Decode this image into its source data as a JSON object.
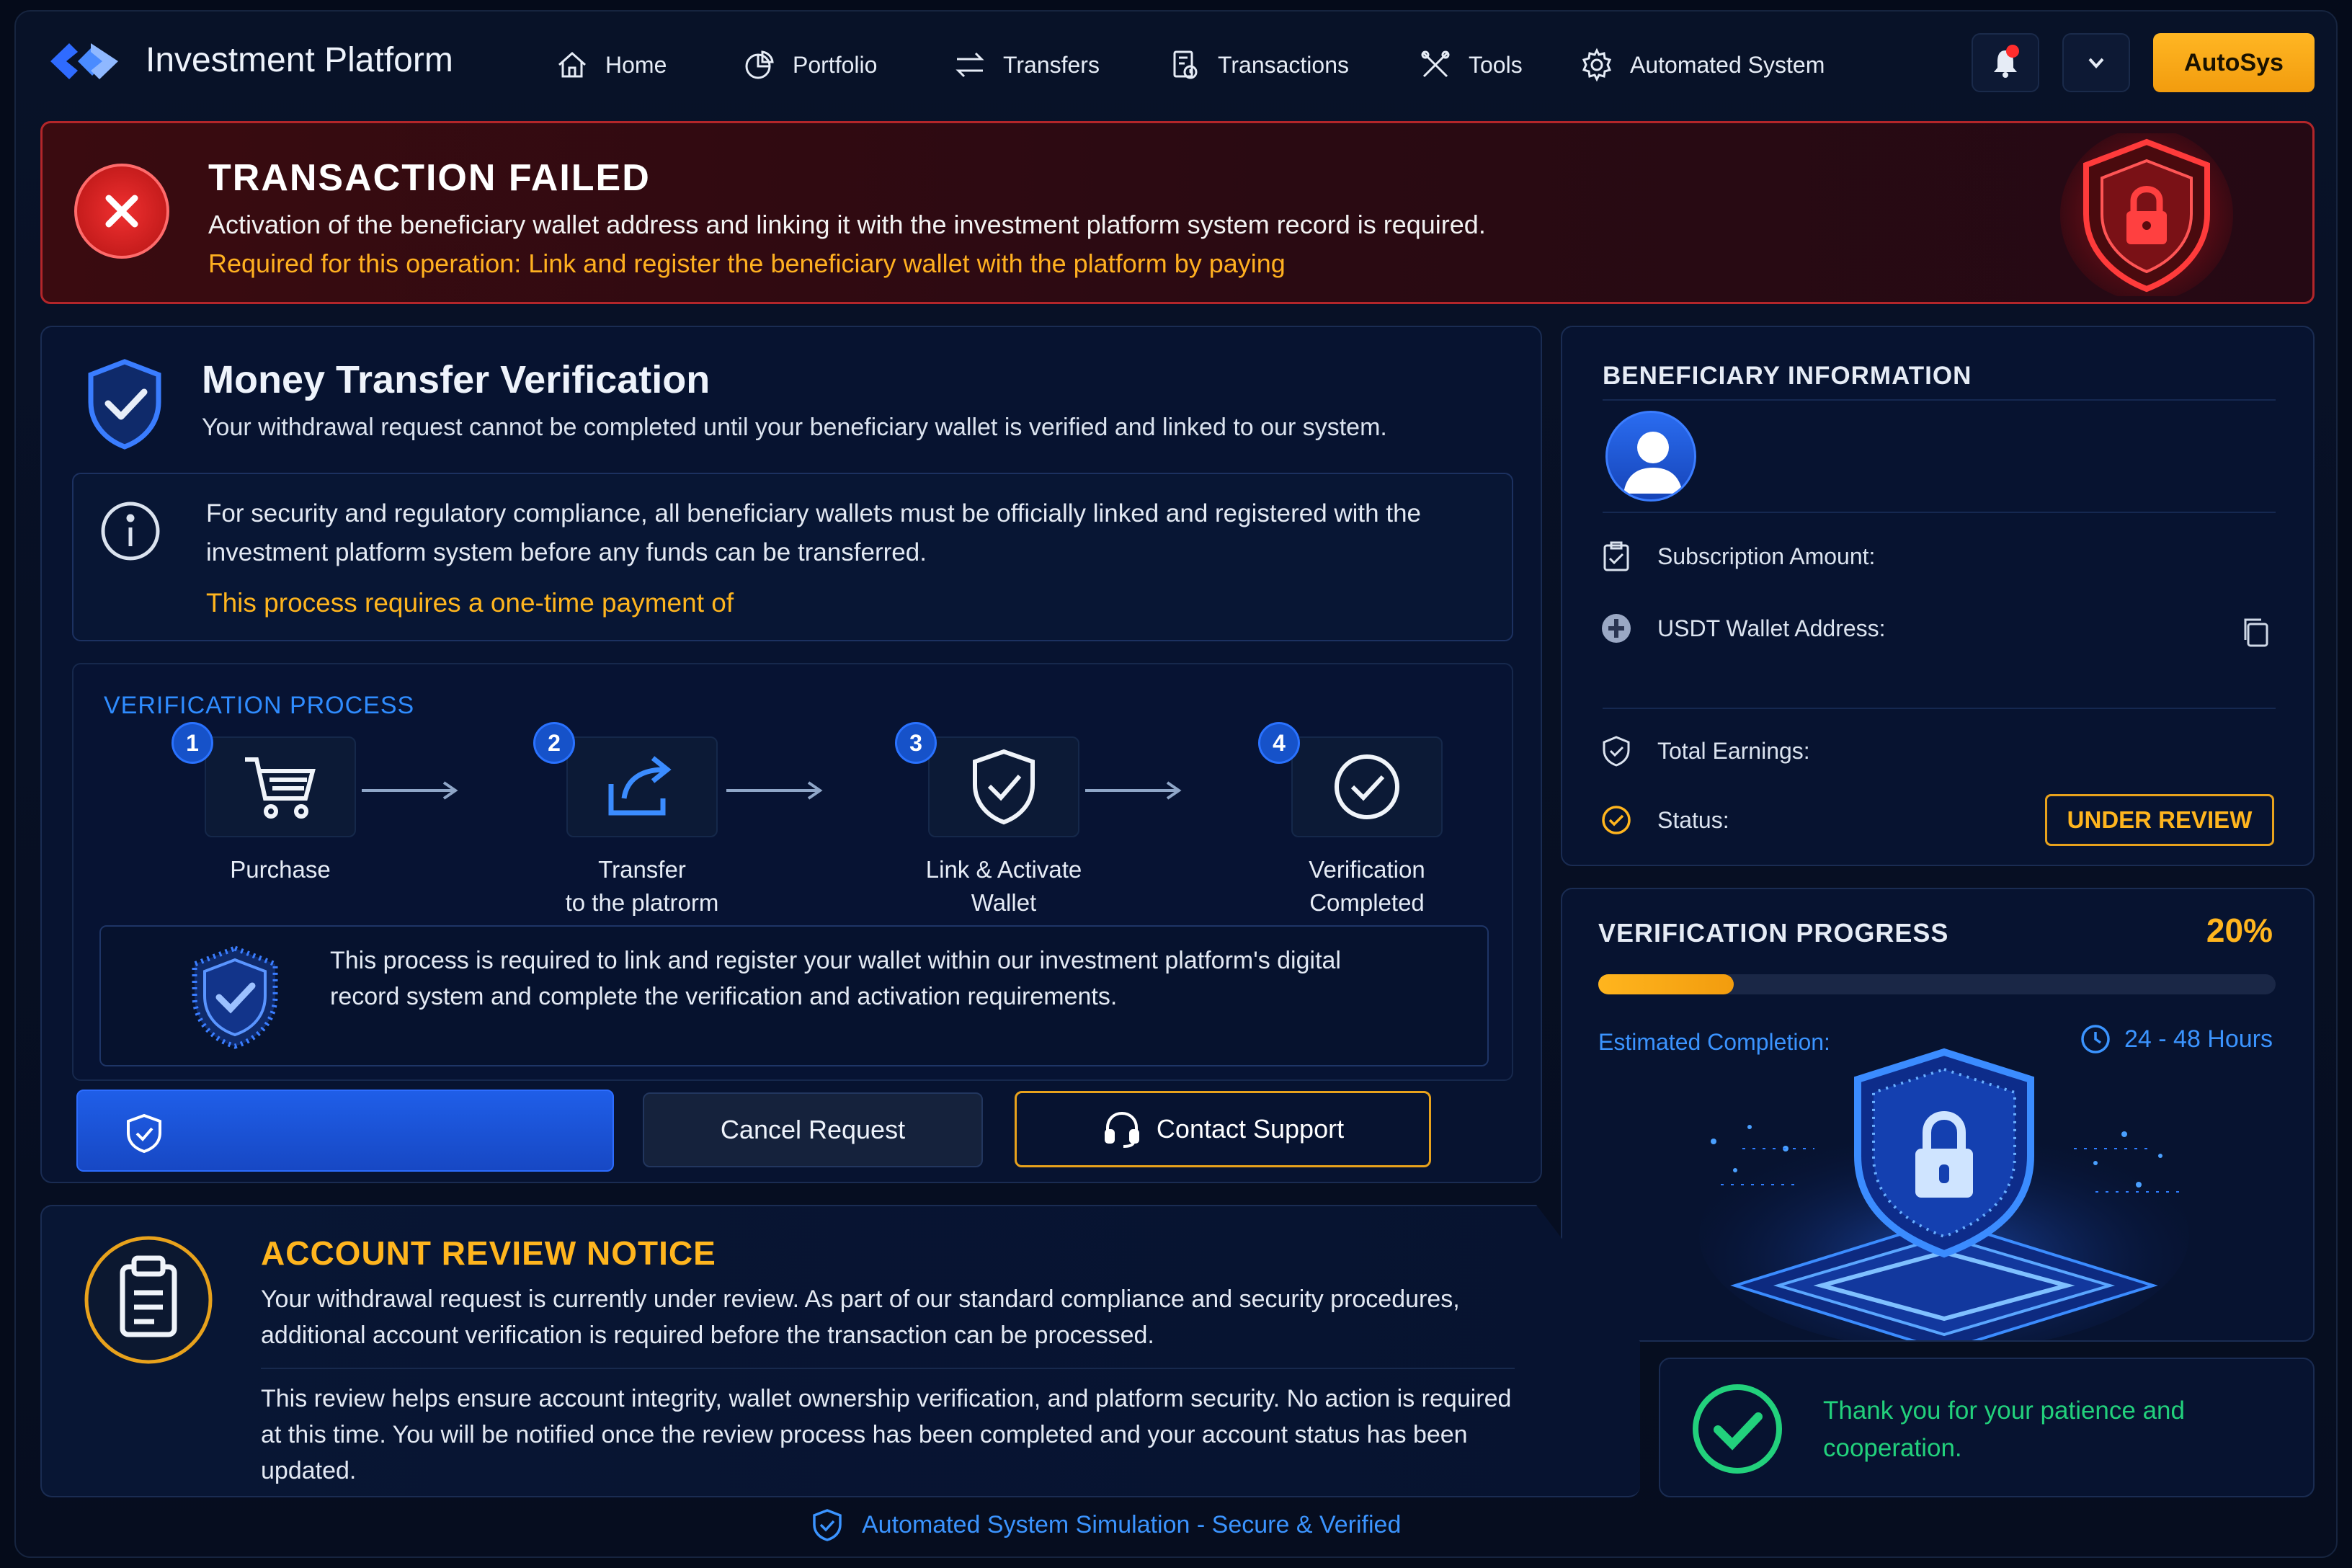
{
  "app": {
    "brand": "Investment Platform"
  },
  "nav": {
    "items": [
      {
        "label": "Home",
        "icon": "home-icon"
      },
      {
        "label": "Portfolio",
        "icon": "pie-chart-icon"
      },
      {
        "label": "Transfers",
        "icon": "transfer-icon"
      },
      {
        "label": "Transactions",
        "icon": "transactions-icon"
      },
      {
        "label": "Tools",
        "icon": "tools-icon"
      },
      {
        "label": "Automated System",
        "icon": "gear-icon"
      }
    ],
    "account_button": "AutoSys"
  },
  "alert": {
    "title": "TRANSACTION FAILED",
    "message": "Activation of the beneficiary wallet address and linking it with the investment platform system record is required.",
    "required": "Required for this operation: Link and register the beneficiary wallet with the platform by paying"
  },
  "verification": {
    "title": "Money Transfer Verification",
    "subtitle": "Your withdrawal request cannot be completed until your beneficiary wallet is verified and linked to our system.",
    "info": "For security and regulatory compliance, all beneficiary wallets must be officially linked and registered with the investment platform system before any funds can be transferred.",
    "payment_note": "This process requires a one-time payment of",
    "process_title": "VERIFICATION PROCESS",
    "steps": [
      {
        "num": "1",
        "label": "Purchase"
      },
      {
        "num": "2",
        "label": "Transfer\nto the platrorm"
      },
      {
        "num": "3",
        "label": "Link & Activate\nWallet"
      },
      {
        "num": "4",
        "label": "Verification\nCompleted"
      }
    ],
    "note": "This process is required to link and register your wallet within our investment platform's digital record system and complete the verification and activation requirements.",
    "cancel_label": "Cancel Request",
    "support_label": "Contact Support"
  },
  "beneficiary": {
    "title": "BENEFICIARY INFORMATION",
    "subscription_label": "Subscription Amount:",
    "wallet_label": "USDT Wallet Address:",
    "earnings_label": "Total Earnings:",
    "status_label": "Status:",
    "status_value": "UNDER REVIEW"
  },
  "progress": {
    "title": "VERIFICATION PROGRESS",
    "percent_label": "20%",
    "percent": 20,
    "est_label": "Estimated Completion:",
    "est_value": "24 - 48 Hours"
  },
  "notice": {
    "title": "ACCOUNT REVIEW NOTICE",
    "p1": "Your withdrawal request is currently under review. As part of our standard compliance and security procedures, additional account verification is required before the transaction can be processed.",
    "p2": "This review helps ensure account integrity, wallet ownership verification, and platform security. No action is required at this time. You will be notified once the review process has been completed and your account status has been updated."
  },
  "thanks": {
    "text": "Thank you for your patience and cooperation."
  },
  "footer": {
    "text": "Automated System Simulation - Secure & Verified"
  },
  "colors": {
    "accent": "#ffb51e",
    "danger": "#b3262a",
    "primary": "#1f5ee8",
    "success": "#22d17c",
    "link": "#3b94ff"
  }
}
